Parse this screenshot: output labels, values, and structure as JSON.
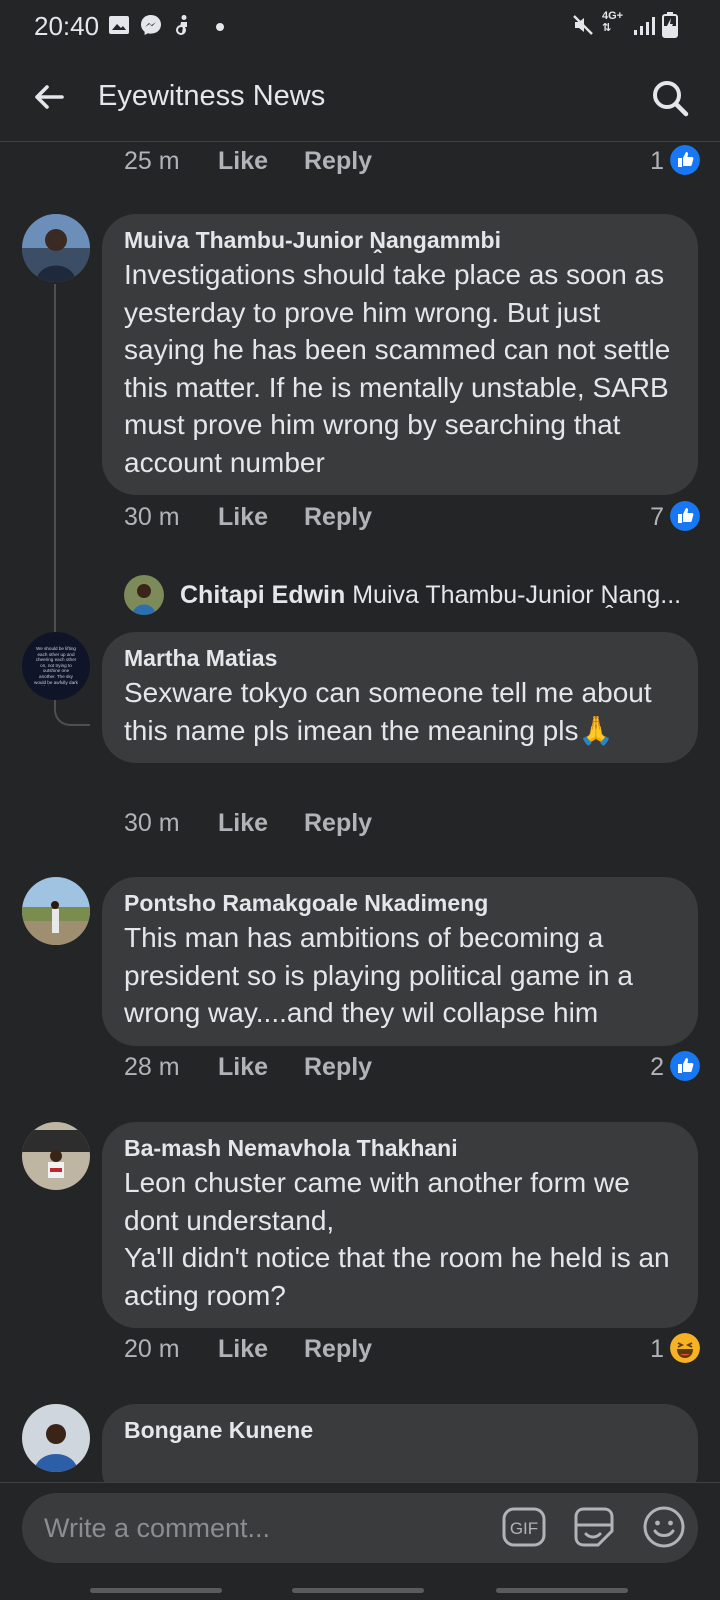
{
  "status_bar": {
    "time": "20:40",
    "network": "4G+"
  },
  "header": {
    "title": "Eyewitness News",
    "back_icon": "back-arrow-icon",
    "search_icon": "search-icon"
  },
  "comments": [
    {
      "time": "25 m",
      "like_label": "Like",
      "reply_label": "Reply",
      "reaction_count": "1",
      "reaction": "like"
    },
    {
      "author": "Muiva Thambu-Junior Ṋangammbi",
      "text": "Investigations should take place as soon as yesterday to prove him wrong. But just saying he has been scammed can not settle this matter. If he is mentally unstable, SARB must prove him wrong by searching that account number",
      "time": "30 m",
      "like_label": "Like",
      "reply_label": "Reply",
      "reaction_count": "7",
      "reaction": "like",
      "reply_preview": {
        "author": "Chitapi Edwin",
        "snippet": "Muiva Thambu-Junior Ṋang..."
      }
    },
    {
      "author": "Martha Matias",
      "text": "Sexware tokyo can someone tell me about this name pls imean the meaning pls🙏",
      "time": "30 m",
      "like_label": "Like",
      "reply_label": "Reply",
      "avatar_text": "We should be lifting each other up and cheering each other on, not trying to outshine one another. The sky would be awfully dark with just one star."
    },
    {
      "author": "Pontsho Ramakgoale Nkadimeng",
      "text": "This man has ambitions of becoming a president so is playing political game in a wrong way....and they wil collapse him",
      "time": "28 m",
      "like_label": "Like",
      "reply_label": "Reply",
      "reaction_count": "2",
      "reaction": "like"
    },
    {
      "author": "Ba-mash Nemavhola Thakhani",
      "text": "Leon chuster came with another form we dont understand,\nYa'll didn't notice that the room he held is an acting room?",
      "time": "20 m",
      "like_label": "Like",
      "reply_label": "Reply",
      "reaction_count": "1",
      "reaction": "haha"
    },
    {
      "author": "Bongane Kunene"
    }
  ],
  "composer": {
    "placeholder": "Write a comment...",
    "gif_label": "GIF"
  },
  "colors": {
    "background": "#242526",
    "bubble": "#3a3b3c",
    "like_blue": "#1877f2",
    "muted_text": "#b0b3b8"
  }
}
